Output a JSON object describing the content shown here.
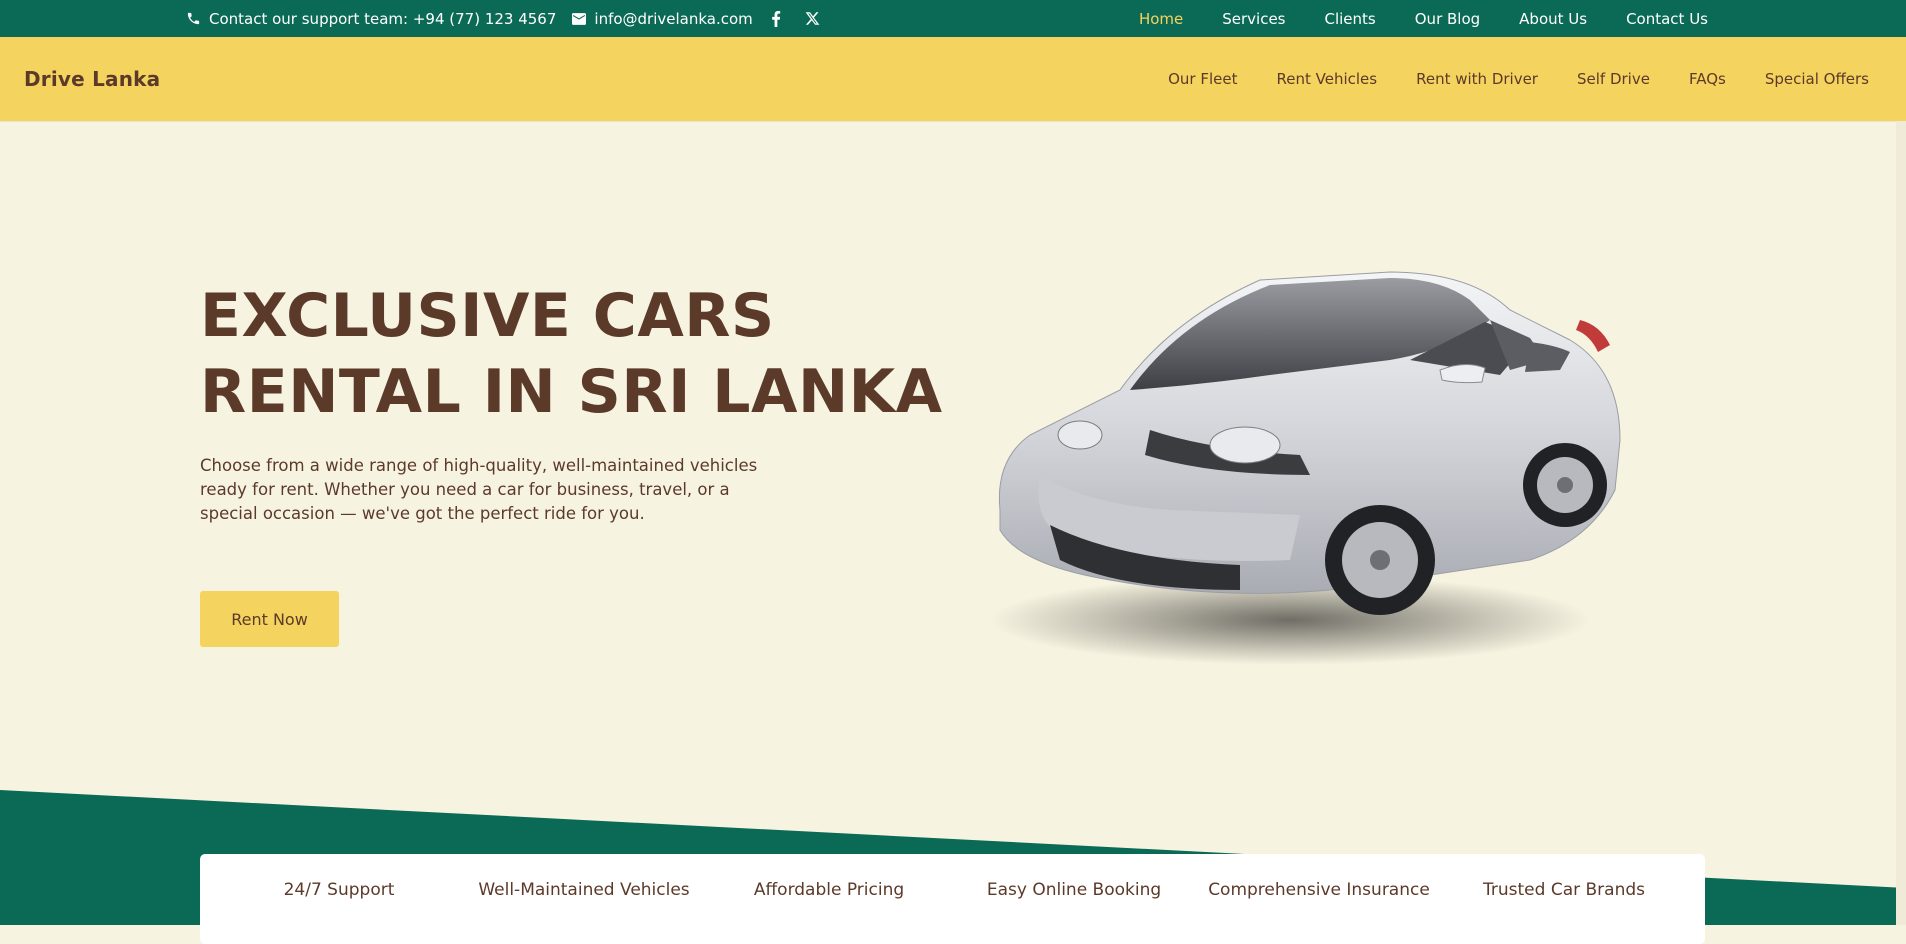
{
  "topbar": {
    "phone_text": "Contact our support team: +94 (77) 123 4567",
    "email_text": "info@drivelanka.com",
    "social": [
      "facebook-icon",
      "x-icon"
    ],
    "nav": [
      {
        "label": "Home",
        "active": true
      },
      {
        "label": "Services"
      },
      {
        "label": "Clients"
      },
      {
        "label": "Our Blog"
      },
      {
        "label": "About Us"
      },
      {
        "label": "Contact Us"
      }
    ]
  },
  "header": {
    "brand": "Drive Lanka",
    "nav": [
      "Our Fleet",
      "Rent Vehicles",
      "Rent with Driver",
      "Self Drive",
      "FAQs",
      "Special Offers"
    ]
  },
  "hero": {
    "title_line1": "EXCLUSIVE CARS",
    "title_line2": "RENTAL IN SRI LANKA",
    "description": "Choose from a wide range of high-quality, well-maintained vehicles ready for rent. Whether you need a car for business, travel, or a special occasion — we've got the perfect ride for you.",
    "cta": "Rent Now"
  },
  "features": [
    "24/7 Support",
    "Well-Maintained Vehicles",
    "Affordable Pricing",
    "Easy Online Booking",
    "Comprehensive Insurance",
    "Trusted Car Brands"
  ],
  "colors": {
    "topbar_bg": "#0b6a55",
    "header_bg": "#f4d35e",
    "page_bg": "#f7f3e1",
    "text_brown": "#5c3a2a",
    "active_link": "#f5d35e"
  }
}
